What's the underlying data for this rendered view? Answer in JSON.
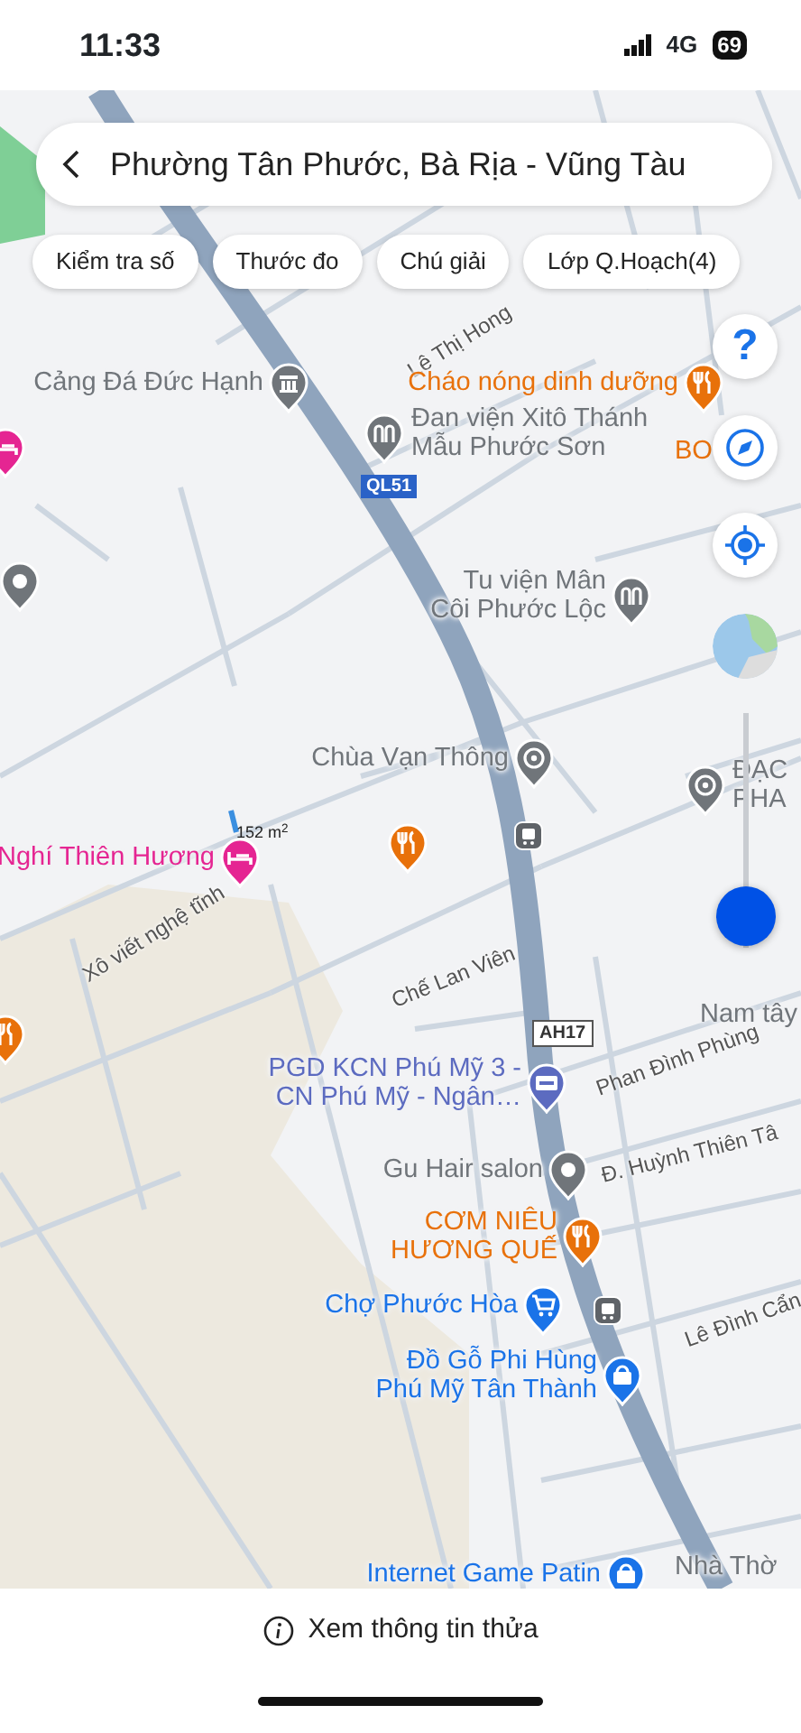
{
  "status_bar": {
    "time": "11:33",
    "network": "4G",
    "battery": "69"
  },
  "header": {
    "title": "Phường Tân Phước, Bà Rịa - Vũng Tàu"
  },
  "chips": [
    {
      "label": "Kiểm tra số"
    },
    {
      "label": "Thước đo"
    },
    {
      "label": "Chú giải"
    },
    {
      "label": "Lớp Q.Hoạch(4)"
    }
  ],
  "map": {
    "road_labels": [
      {
        "text": "Lê Thị Hong",
        "kind": "street"
      },
      {
        "text": "QL51",
        "kind": "shield"
      },
      {
        "text": "Xô viết nghệ tĩnh",
        "kind": "street"
      },
      {
        "text": "Chế Lan Viên",
        "kind": "street"
      },
      {
        "text": "AH17",
        "kind": "shield"
      },
      {
        "text": "Phan Đình Phùng",
        "kind": "street"
      },
      {
        "text": "Đ. Huỳnh Thiên Tâ",
        "kind": "street"
      },
      {
        "text": "Lê Đình Cẩn",
        "kind": "street"
      }
    ],
    "area_label": "152 m$^{2}$",
    "places": [
      {
        "name": "Cảng Đá Đức Hạnh",
        "kind": "landmark",
        "color": "#70757a"
      },
      {
        "name": "Cháo nóng dinh dưỡng",
        "kind": "restaurant",
        "color": "#e8710a"
      },
      {
        "name": "Đan viện Xitô Thánh\nMẫu Phước Sơn",
        "kind": "worship",
        "color": "#70757a"
      },
      {
        "name": "BO",
        "kind": "label",
        "color": "#e8710a"
      },
      {
        "kind": "hotel",
        "color": "#e52592"
      },
      {
        "kind": "generic",
        "color": "#70757a"
      },
      {
        "name": "Tu viện Mân\nCôi Phước Lộc",
        "kind": "worship",
        "color": "#70757a"
      },
      {
        "name": "Chùa Vạn Thông",
        "kind": "temple",
        "color": "#70757a"
      },
      {
        "name": "ĐẠC\nPHA",
        "kind": "temple",
        "color": "#70757a"
      },
      {
        "name": "Nghí Thiên Hương",
        "kind": "hotel",
        "color": "#e52592"
      },
      {
        "kind": "restaurant",
        "color": "#e8710a"
      },
      {
        "kind": "bus",
        "color": "#5f6368"
      },
      {
        "name": "Nam tây",
        "kind": "label",
        "color": "#70757a"
      },
      {
        "kind": "restaurant",
        "color": "#e8710a"
      },
      {
        "name": "PGD KCN Phú Mỹ 3 -\nCN Phú Mỹ - Ngân…",
        "kind": "bank",
        "color": "#5c6bc0"
      },
      {
        "name": "Gu Hair salon",
        "kind": "generic",
        "color": "#70757a"
      },
      {
        "name": "CƠM NIÊU\nHƯƠNG QUẾ",
        "kind": "restaurant",
        "color": "#e8710a"
      },
      {
        "name": "Chợ Phước Hòa",
        "kind": "shop",
        "color": "#1a73e8"
      },
      {
        "kind": "bus",
        "color": "#5f6368"
      },
      {
        "name": "Đồ Gỗ Phi Hùng\nPhú Mỹ Tân Thành",
        "kind": "store",
        "color": "#1a73e8"
      },
      {
        "name": "Internet Game Patin",
        "kind": "store",
        "color": "#1a73e8"
      },
      {
        "name": "Nhà Thờ",
        "kind": "label",
        "color": "#70757a"
      }
    ]
  },
  "controls": {
    "help_label": "?",
    "zoom": {
      "level": 0.14
    }
  },
  "bottom_bar": {
    "label": "Xem thông tin thửa"
  }
}
